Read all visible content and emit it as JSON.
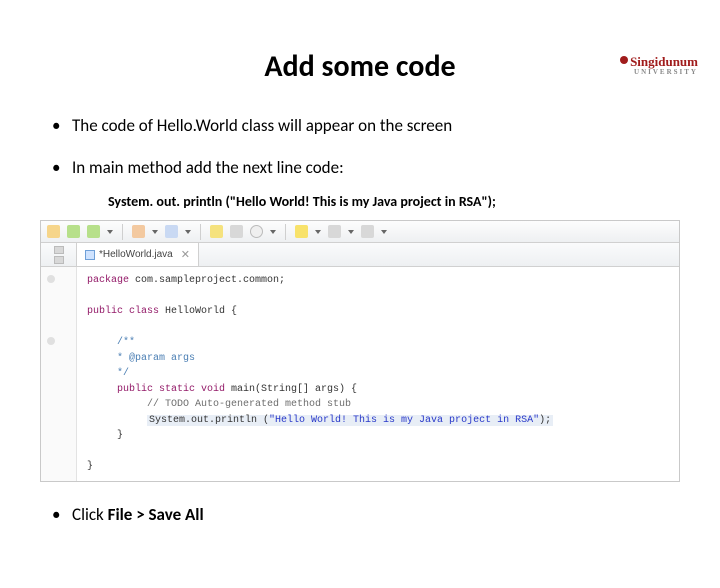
{
  "logo": {
    "name": "Singidunum",
    "sub": "UNIVERSITY"
  },
  "title": "Add some code",
  "bullets": {
    "b1": "The code of Hello.World class will appear on the screen",
    "b2": "In main method add the next line code:",
    "b3_pre": "Click ",
    "b3_bold": "File > Save All"
  },
  "codeline": "System. out. println (\"Hello World! This is my Java project in RSA\");",
  "ide": {
    "tab": {
      "name": "*HelloWorld.java",
      "close": "✕"
    },
    "code": {
      "l1a": "package",
      "l1b": " com.sampleproject.common;",
      "l2a": "public class",
      "l2b": " HelloWorld {",
      "l3": "/**",
      "l4": " * @param args",
      "l5": " */",
      "l6a": "public static void",
      "l6b": " main(String[] args) {",
      "l7": "// TODO Auto-generated method stub",
      "l8a": "System.out.println (",
      "l8b": "\"Hello World! This is my Java project in RSA\"",
      "l8c": ");",
      "l9": "}",
      "l10": "}"
    }
  }
}
